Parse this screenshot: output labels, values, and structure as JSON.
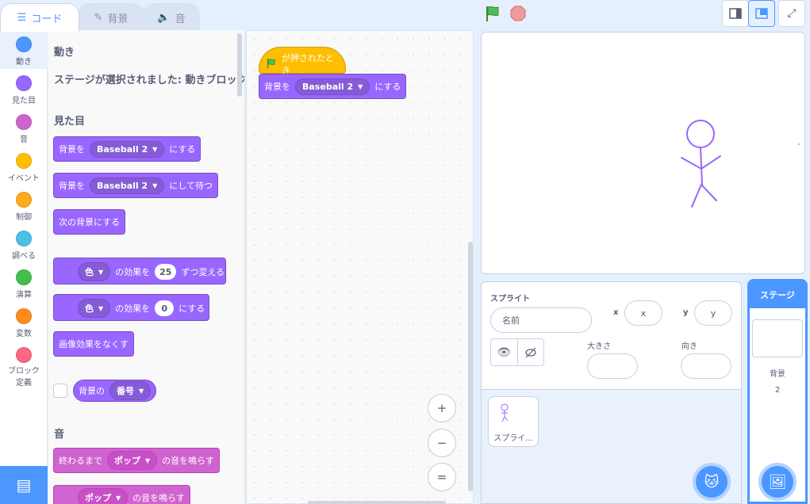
{
  "tabs": [
    {
      "label": "コード",
      "icon": "code-icon"
    },
    {
      "label": "背景",
      "icon": "brush-icon"
    },
    {
      "label": "音",
      "icon": "speaker-icon"
    }
  ],
  "categories": [
    {
      "label": "動き",
      "color": "#4c97ff"
    },
    {
      "label": "見た目",
      "color": "#9966ff"
    },
    {
      "label": "音",
      "color": "#cf63cf"
    },
    {
      "label": "イベント",
      "color": "#ffbf00"
    },
    {
      "label": "制御",
      "color": "#ffab19"
    },
    {
      "label": "調べる",
      "color": "#4cbfe6"
    },
    {
      "label": "演算",
      "color": "#40bf4a"
    },
    {
      "label": "変数",
      "color": "#ff8c1a"
    },
    {
      "label": "ブロック定義",
      "color": "#ff6680"
    }
  ],
  "palette": {
    "motion_title": "動き",
    "motion_note": "ステージが選択されました: 動きブロックはありません",
    "looks_title": "見た目",
    "b1": {
      "pre": "背景を",
      "dd": "Baseball 2",
      "post": "にする"
    },
    "b2": {
      "pre": "背景を",
      "dd": "Baseball 2",
      "post": "にして待つ"
    },
    "b3": {
      "text": "次の背景にする"
    },
    "b4": {
      "dd": "色",
      "mid": "の効果を",
      "num": "25",
      "post": "ずつ変える"
    },
    "b5": {
      "dd": "色",
      "mid": "の効果を",
      "num": "0",
      "post": "にする"
    },
    "b6": {
      "text": "画像効果をなくす"
    },
    "b7": {
      "pre": "背景の",
      "dd": "番号"
    },
    "sound_title": "音",
    "s1": {
      "pre": "終わるまで",
      "dd": "ポップ",
      "post": "の音を鳴らす"
    },
    "s2": {
      "dd": "ポップ",
      "post": "の音を鳴らす"
    }
  },
  "script": {
    "hat_label": "が押されたとき",
    "blk": {
      "pre": "背景を",
      "dd": "Baseball 2",
      "post": "にする"
    }
  },
  "zoom": {
    "in": "+",
    "out": "−",
    "reset": "="
  },
  "sprite_panel": {
    "title": "スプライト",
    "name_placeholder": "名前",
    "x_label": "x",
    "x_placeholder": "x",
    "y_label": "y",
    "y_placeholder": "y",
    "size_label": "大きさ",
    "dir_label": "向き",
    "sprite_name": "スプライ..."
  },
  "stage_panel": {
    "title": "ステージ",
    "backdrop_label": "背景",
    "backdrop_count": "2"
  }
}
